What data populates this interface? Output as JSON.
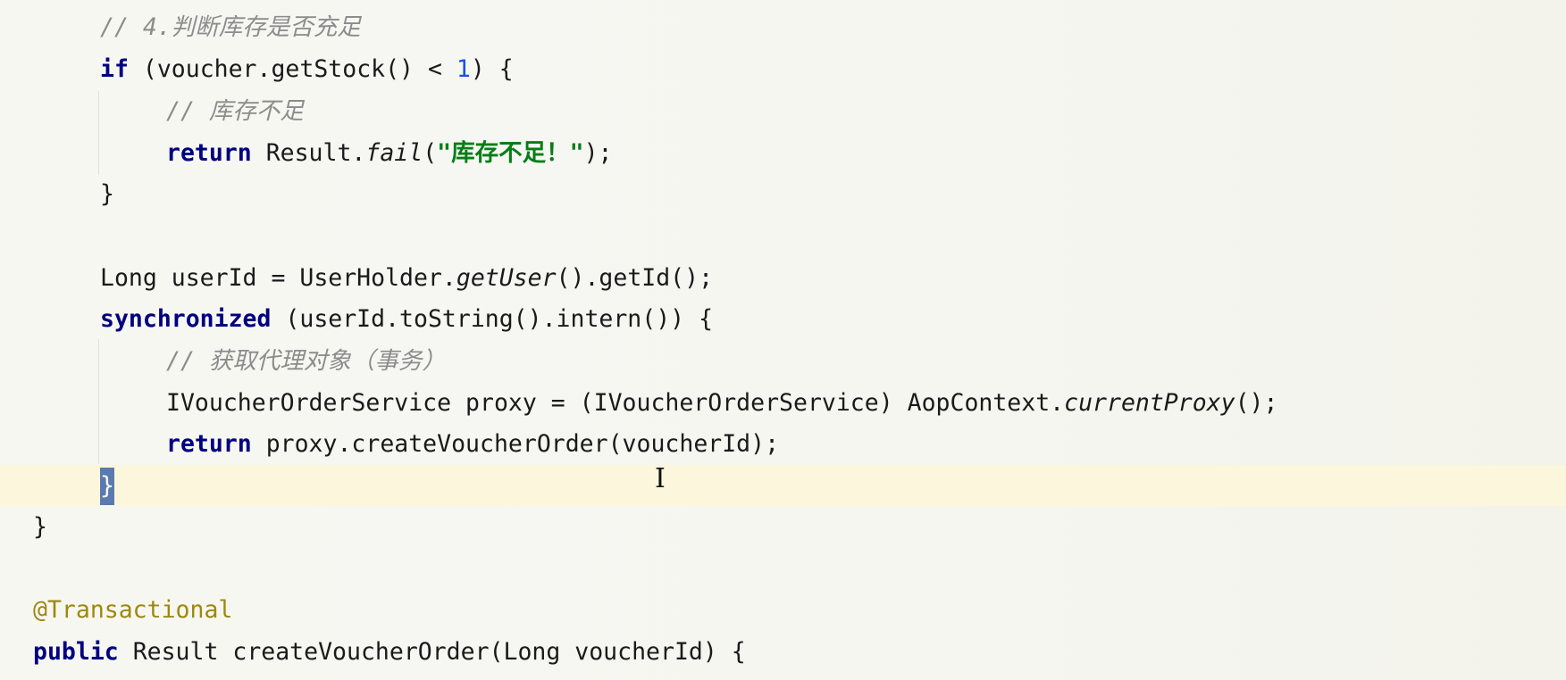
{
  "editor": {
    "lines": [
      {
        "tokens": [
          {
            "t": "// 4.判断库存是否充足",
            "c": "cm"
          }
        ]
      },
      {
        "tokens": [
          {
            "t": "if",
            "c": "kw"
          },
          {
            "t": " (voucher.getStock() < "
          },
          {
            "t": "1",
            "c": "num"
          },
          {
            "t": ") {"
          }
        ]
      },
      {
        "tokens": [
          {
            "t": "// 库存不足",
            "c": "cm"
          }
        ]
      },
      {
        "tokens": [
          {
            "t": "return",
            "c": "kw"
          },
          {
            "t": " Result."
          },
          {
            "t": "fail",
            "c": "it"
          },
          {
            "t": "("
          },
          {
            "t": "\"库存不足！\"",
            "c": "str"
          },
          {
            "t": ");"
          }
        ]
      },
      {
        "tokens": [
          {
            "t": "}"
          }
        ]
      },
      {
        "tokens": []
      },
      {
        "tokens": [
          {
            "t": "Long userId = UserHolder."
          },
          {
            "t": "getUser",
            "c": "it"
          },
          {
            "t": "().getId();"
          }
        ]
      },
      {
        "tokens": [
          {
            "t": "synchronized",
            "c": "kw"
          },
          {
            "t": " (userId.toString().intern()) {"
          }
        ]
      },
      {
        "tokens": [
          {
            "t": "// 获取代理对象（事务）",
            "c": "cm"
          }
        ]
      },
      {
        "tokens": [
          {
            "t": "IVoucherOrderService proxy = (IVoucherOrderService) AopContext."
          },
          {
            "t": "currentProxy",
            "c": "it"
          },
          {
            "t": "();"
          }
        ]
      },
      {
        "tokens": [
          {
            "t": "return",
            "c": "kw"
          },
          {
            "t": " proxy.createVoucherOrder(voucherId);"
          }
        ]
      },
      {
        "tokens": [
          {
            "t": "}",
            "c": "brace-hl"
          }
        ]
      },
      {
        "tokens": [
          {
            "t": "}"
          }
        ]
      },
      {
        "tokens": []
      },
      {
        "tokens": [
          {
            "t": "@Transactional",
            "c": "ann"
          }
        ]
      },
      {
        "tokens": [
          {
            "t": "public",
            "c": "kw"
          },
          {
            "t": " Result createVoucherOrder(Long voucherId) {"
          }
        ]
      }
    ],
    "mouse_cursor_glyph": "I",
    "colors": {
      "background": "#f7f7f2",
      "current_line": "#fbf6dc",
      "keyword": "#000080",
      "comment": "#8c8c8c",
      "number": "#1750eb",
      "string": "#067d17",
      "annotation": "#9e880d",
      "brace_match": "#5b7ab0"
    }
  }
}
